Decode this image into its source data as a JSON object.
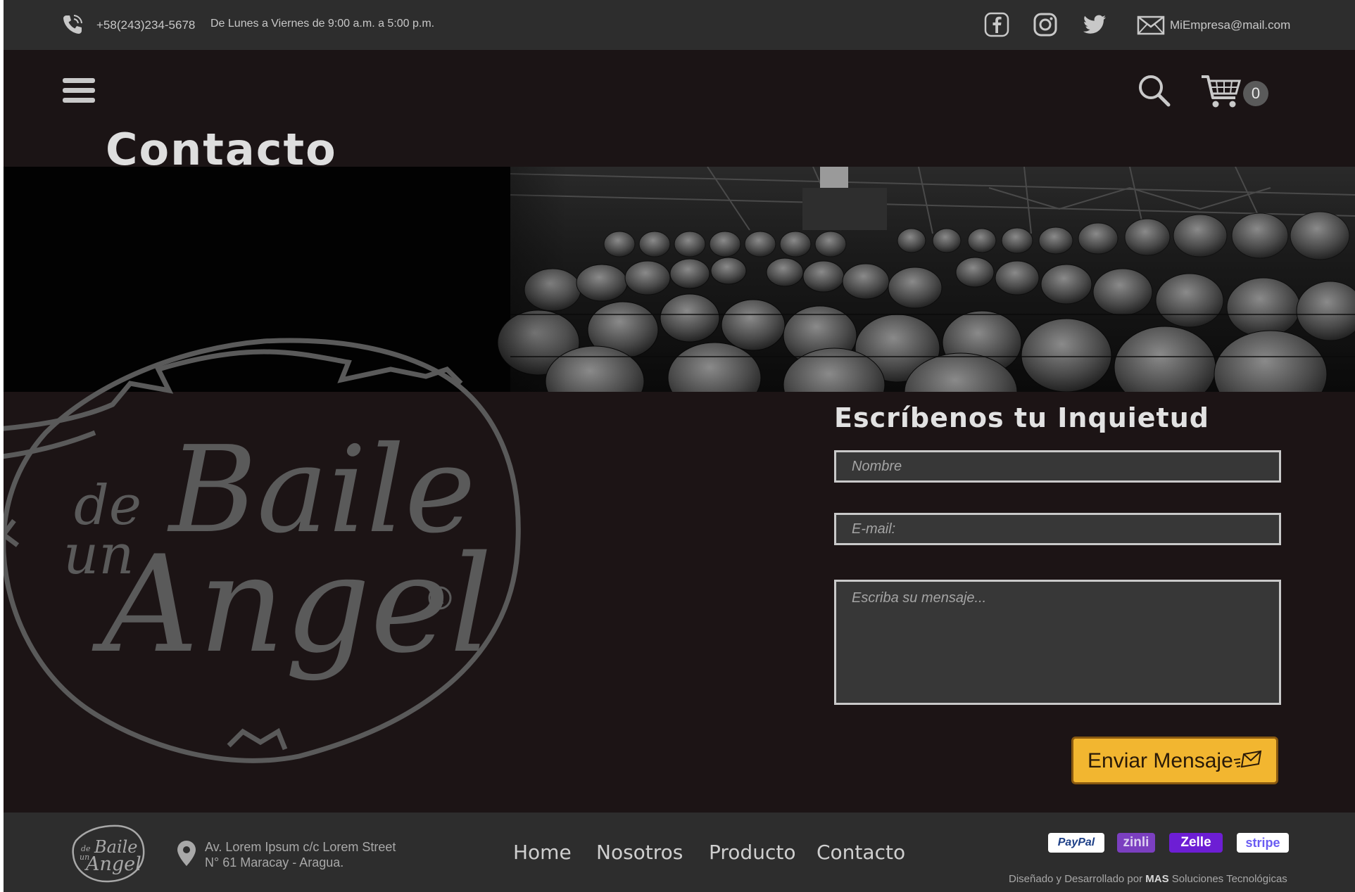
{
  "topbar": {
    "phone": "+58(243)234-5678",
    "hours": "De Lunes a Viernes de 9:00 a.m. a 5:00 p.m.",
    "email": "MiEmpresa@mail.com",
    "social_icons": [
      "facebook-icon",
      "instagram-icon",
      "twitter-icon"
    ]
  },
  "header": {
    "cart_count": "0"
  },
  "page": {
    "title": "Contacto"
  },
  "brand": {
    "logo_text": "de un Baile Angel"
  },
  "form": {
    "title": "Escríbenos tu Inquietud",
    "name_placeholder": "Nombre",
    "email_placeholder": "E-mail:",
    "message_placeholder": "Escriba su mensaje...",
    "submit_label": "Enviar Mensaje"
  },
  "footer": {
    "address_line1": "Av. Lorem Ipsum c/c  Lorem Street",
    "address_line2": "N° 61 Maracay - Aragua.",
    "nav": [
      "Home",
      "Nosotros",
      "Producto",
      "Contacto"
    ],
    "payments": [
      "PayPal",
      "zinli",
      "Zelle",
      "stripe"
    ],
    "credit_prefix": "Diseñado y Desarrollado por",
    "credit_brand": "MAS",
    "credit_suffix": "Soluciones Tecnológicas"
  },
  "colors": {
    "accent": "#f2b630",
    "background": "#1c1415",
    "topbar": "#2d2d2d"
  }
}
